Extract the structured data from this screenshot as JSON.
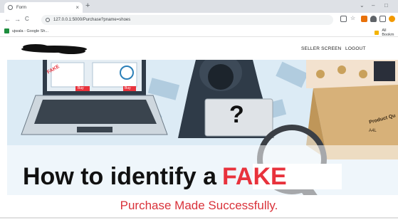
{
  "browser": {
    "tab_title": "Form",
    "tab_close": "×",
    "new_tab": "+",
    "url": "127.0.0.1:5000/Purchase?pname=shoes",
    "nav_back": "←",
    "nav_forward": "→",
    "nav_reload": "C",
    "minimize": "–",
    "maximize": "□",
    "window_menu": "⌄"
  },
  "bookmarks": {
    "items": [
      {
        "label": "ujwala - Google Sh..."
      }
    ],
    "all_bookmarks": "All Bookm"
  },
  "navbar": {
    "seller_screen": "SELLER SCREEN",
    "logout": "LOGOUT"
  },
  "hero": {
    "title_prefix": "How to identify a",
    "title_fake": "FAKE",
    "laptop_badge": "FAKE",
    "buy_label": "Buy",
    "question_mark": "?",
    "box_label": "Product Qu",
    "box_size": "A4L"
  },
  "message": {
    "text": "Purchase Made Successfully."
  },
  "colors": {
    "accent_red": "#d9323a",
    "fake_red": "#e8323c"
  }
}
